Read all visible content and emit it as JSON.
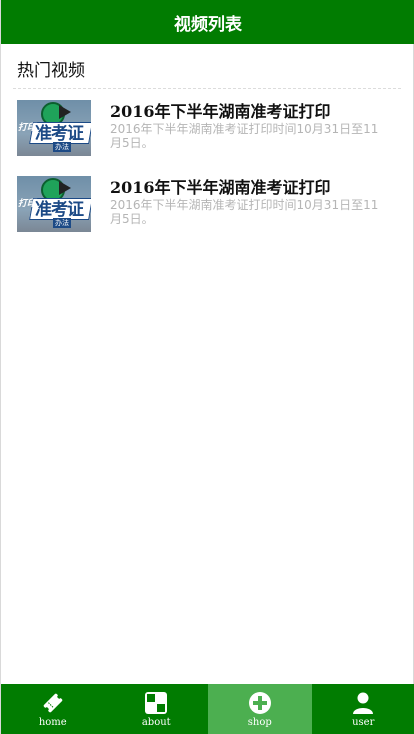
{
  "header": {
    "title": "视频列表"
  },
  "section": {
    "title": "热门视频"
  },
  "videos": [
    {
      "thumb_small_text": "打印",
      "thumb_big_text": "准考证",
      "thumb_tag_text": "办法",
      "title": "2016年下半年湖南准考证打印",
      "description": "2016年下半年湖南准考证打印时间10月31日至11月5日。"
    },
    {
      "thumb_small_text": "打印",
      "thumb_big_text": "准考证",
      "thumb_tag_text": "办法",
      "title": "2016年下半年湖南准考证打印",
      "description": "2016年下半年湖南准考证打印时间10月31日至11月5日。"
    }
  ],
  "tabbar": {
    "items": [
      {
        "label": "home",
        "icon": "ticket-icon",
        "active": false
      },
      {
        "label": "about",
        "icon": "grid-icon",
        "active": false
      },
      {
        "label": "shop",
        "icon": "plus-circle-icon",
        "active": true
      },
      {
        "label": "user",
        "icon": "user-icon",
        "active": false
      }
    ]
  },
  "colors": {
    "primary": "#017c01",
    "active_tab": "#4caf50",
    "muted_text": "#b5b5b5"
  }
}
